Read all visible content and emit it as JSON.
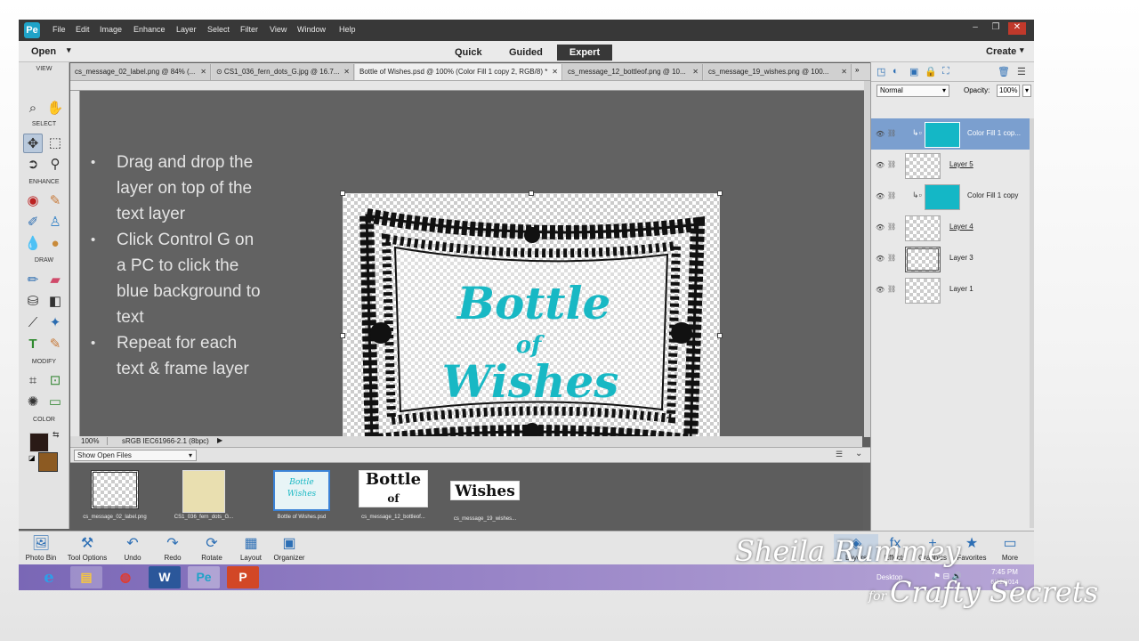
{
  "menubar": {
    "items": [
      "File",
      "Edit",
      "Image",
      "Enhance",
      "Layer",
      "Select",
      "Filter",
      "View",
      "Window",
      "Help"
    ],
    "minimize": "–",
    "restore": "❐",
    "close": "✕"
  },
  "modebar": {
    "open": "Open",
    "modes": [
      "Quick",
      "Guided",
      "Expert"
    ],
    "active_mode": "Expert",
    "create": "Create"
  },
  "tabs": [
    {
      "label": "cs_message_02_label.png @ 84% (...",
      "active": false
    },
    {
      "label": "⊙ CS1_036_fern_dots_G.jpg @ 16.7...",
      "active": false
    },
    {
      "label": "Bottle of Wishes.psd @ 100% (Color Fill 1 copy 2, RGB/8) *",
      "active": true
    },
    {
      "label": "cs_message_12_bottleof.png @ 10...",
      "active": false
    },
    {
      "label": "cs_message_19_wishes.png @ 100...",
      "active": false
    }
  ],
  "toolbox": {
    "sections": [
      "VIEW",
      "SELECT",
      "ENHANCE",
      "DRAW",
      "MODIFY",
      "COLOR"
    ],
    "foreground_color": "#2a1a16",
    "background_color": "#8c5a22"
  },
  "canvas": {
    "bullets": [
      "Drag and drop the layer on top of the text layer",
      "Click Control G on a PC to click the blue background to text",
      "Repeat for each text & frame layer"
    ],
    "artwork_text": [
      "Bottle",
      "of",
      "Wishes"
    ],
    "accent_color": "#18b8c4"
  },
  "status": {
    "zoom": "100%",
    "profile": "sRGB IEC61966-2.1 (8bpc)"
  },
  "photobin": {
    "dropdown": "Show Open Files",
    "items": [
      {
        "label": "cs_message_02_label.png"
      },
      {
        "label": "CS1_036_fern_dots_G..."
      },
      {
        "label": "Bottle of Wishes.psd"
      },
      {
        "label": "cs_message_12_bottleof..."
      },
      {
        "label": "cs_message_19_wishes..."
      }
    ],
    "thumb_words": [
      "Bottle",
      "of",
      "Wishes"
    ]
  },
  "layers": {
    "blend_mode": "Normal",
    "opacity_label": "Opacity:",
    "opacity": "100%",
    "items": [
      {
        "name": "Color Fill 1 cop...",
        "type": "fill",
        "selected": true
      },
      {
        "name": "Layer 5",
        "type": "text",
        "selected": false
      },
      {
        "name": "Color Fill 1 copy",
        "type": "fill",
        "selected": false
      },
      {
        "name": "Layer 4",
        "type": "text",
        "selected": false
      },
      {
        "name": "Layer 3",
        "type": "frame",
        "selected": false
      },
      {
        "name": "Layer 1",
        "type": "blank",
        "selected": false
      }
    ]
  },
  "bottombar": {
    "left": [
      "Photo Bin",
      "Tool Options",
      "Undo",
      "Redo",
      "Rotate",
      "Layout",
      "Organizer"
    ],
    "right": [
      "Layers",
      "Effects",
      "Graphics",
      "Favorites",
      "More"
    ]
  },
  "taskbar": {
    "desktop": "Desktop",
    "time": "7:45 PM",
    "date": "6/12/2014"
  },
  "signature": {
    "name": "Sheila Rummey",
    "for": "for",
    "brand": "Crafty Secrets"
  }
}
